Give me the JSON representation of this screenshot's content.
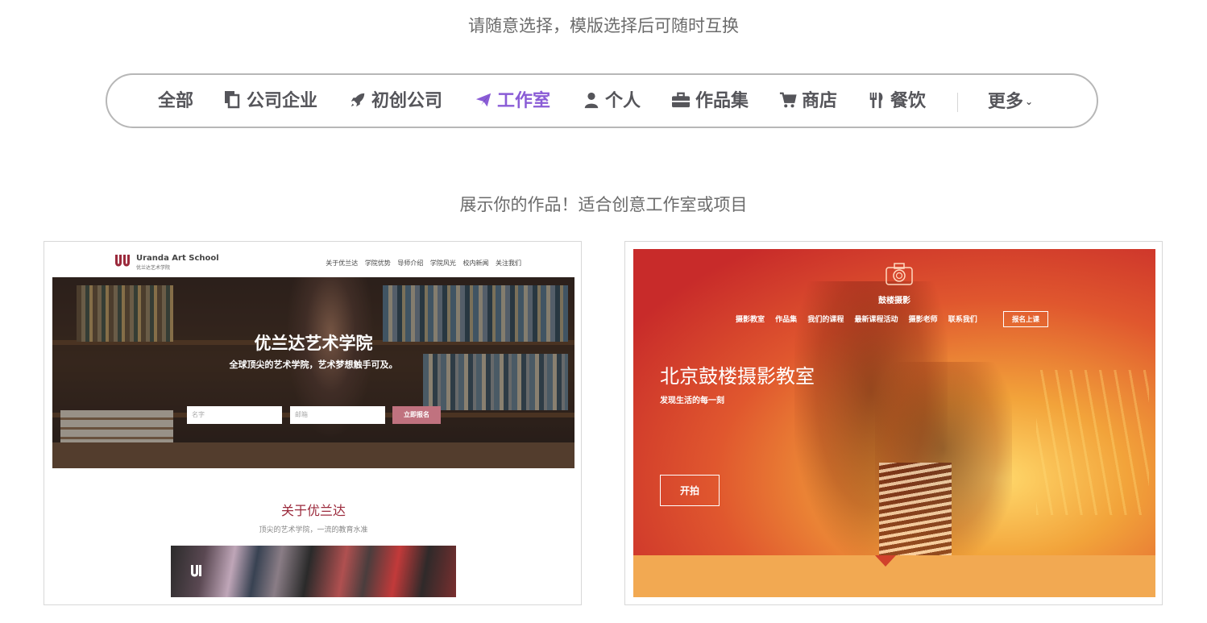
{
  "header": {
    "subtitle": "请随意选择，模版选择后可随时互换"
  },
  "filters": {
    "items": [
      {
        "label": "全部",
        "icon": "none"
      },
      {
        "label": "公司企业",
        "icon": "copy-icon"
      },
      {
        "label": "初创公司",
        "icon": "rocket-icon"
      },
      {
        "label": "工作室",
        "icon": "paper-plane-icon",
        "active": true
      },
      {
        "label": "个人",
        "icon": "user-icon"
      },
      {
        "label": "作品集",
        "icon": "briefcase-icon"
      },
      {
        "label": "商店",
        "icon": "cart-icon"
      },
      {
        "label": "餐饮",
        "icon": "utensils-icon"
      }
    ],
    "more_label": "更多",
    "active_color": "#8a5cd6"
  },
  "section": {
    "title": "展示你的作品！适合创意工作室或项目"
  },
  "templates": {
    "uranda": {
      "brand": "Uranda Art School",
      "brand_sub": "优兰达艺术学院",
      "nav": [
        "关于优兰达",
        "学院优势",
        "导师介绍",
        "学院风光",
        "校内新闻",
        "关注我们"
      ],
      "hero_title": "优兰达艺术学院",
      "hero_subtitle": "全球顶尖的艺术学院，艺术梦想触手可及。",
      "name_placeholder": "名字",
      "email_placeholder": "邮箱",
      "signup_button": "立即报名",
      "about_title": "关于优兰达",
      "about_subtitle": "顶尖的艺术学院，一流的教育水准",
      "accent_color": "#9b2a3c"
    },
    "gulou": {
      "brand": "鼓楼摄影",
      "nav": [
        "摄影教室",
        "作品集",
        "我们的课程",
        "最新课程活动",
        "摄影老师",
        "联系我们"
      ],
      "signup_button": "报名上课",
      "hero_title": "北京鼓楼摄影教室",
      "hero_subtitle": "发现生活的每一刻",
      "start_button": "开拍",
      "bottom_color": "#f2a952"
    }
  }
}
